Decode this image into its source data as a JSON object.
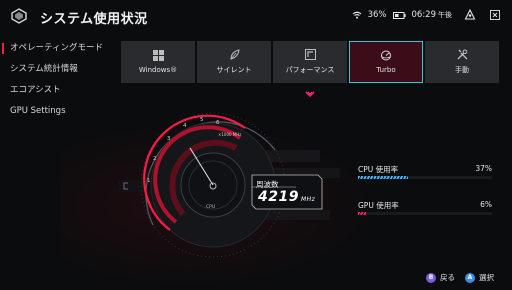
{
  "header": {
    "title": "システム使用状況",
    "battery": "36%",
    "time": "06:29",
    "ampm": "午後"
  },
  "sidebar": {
    "items": [
      {
        "label": "オペレーティングモード",
        "active": true
      },
      {
        "label": "システム統計情報",
        "active": false
      },
      {
        "label": "エコアシスト",
        "active": false
      },
      {
        "label": "GPU Settings",
        "active": false
      }
    ]
  },
  "modes": [
    {
      "label": "Windows®",
      "icon": "windows-icon"
    },
    {
      "label": "サイレント",
      "icon": "leaf-icon"
    },
    {
      "label": "パフォーマンス",
      "icon": "performance-icon"
    },
    {
      "label": "Turbo",
      "icon": "turbo-icon",
      "selected": true
    },
    {
      "label": "手動",
      "icon": "tools-icon"
    }
  ],
  "gauge": {
    "freq_label": "周波数",
    "freq_value": "4219",
    "freq_unit": "MHz",
    "cpu_label": "CPU",
    "scale_label": "×1000 MHz",
    "ticks": [
      "1",
      "2",
      "3",
      "4",
      "5",
      "6"
    ]
  },
  "usage": {
    "cpu": {
      "label": "CPU 使用率",
      "value": "37%",
      "percent": 37
    },
    "gpu": {
      "label": "GPU 使用率",
      "value": "6%",
      "percent": 6
    }
  },
  "footer": {
    "back": "戻る",
    "back_key": "B",
    "select": "選択",
    "select_key": "A"
  },
  "colors": {
    "accent_red": "#ff1a4a",
    "selected_border": "#2ec9d6",
    "cpu_bar": "#3fb5ff",
    "gpu_bar": "#ff2a55"
  }
}
